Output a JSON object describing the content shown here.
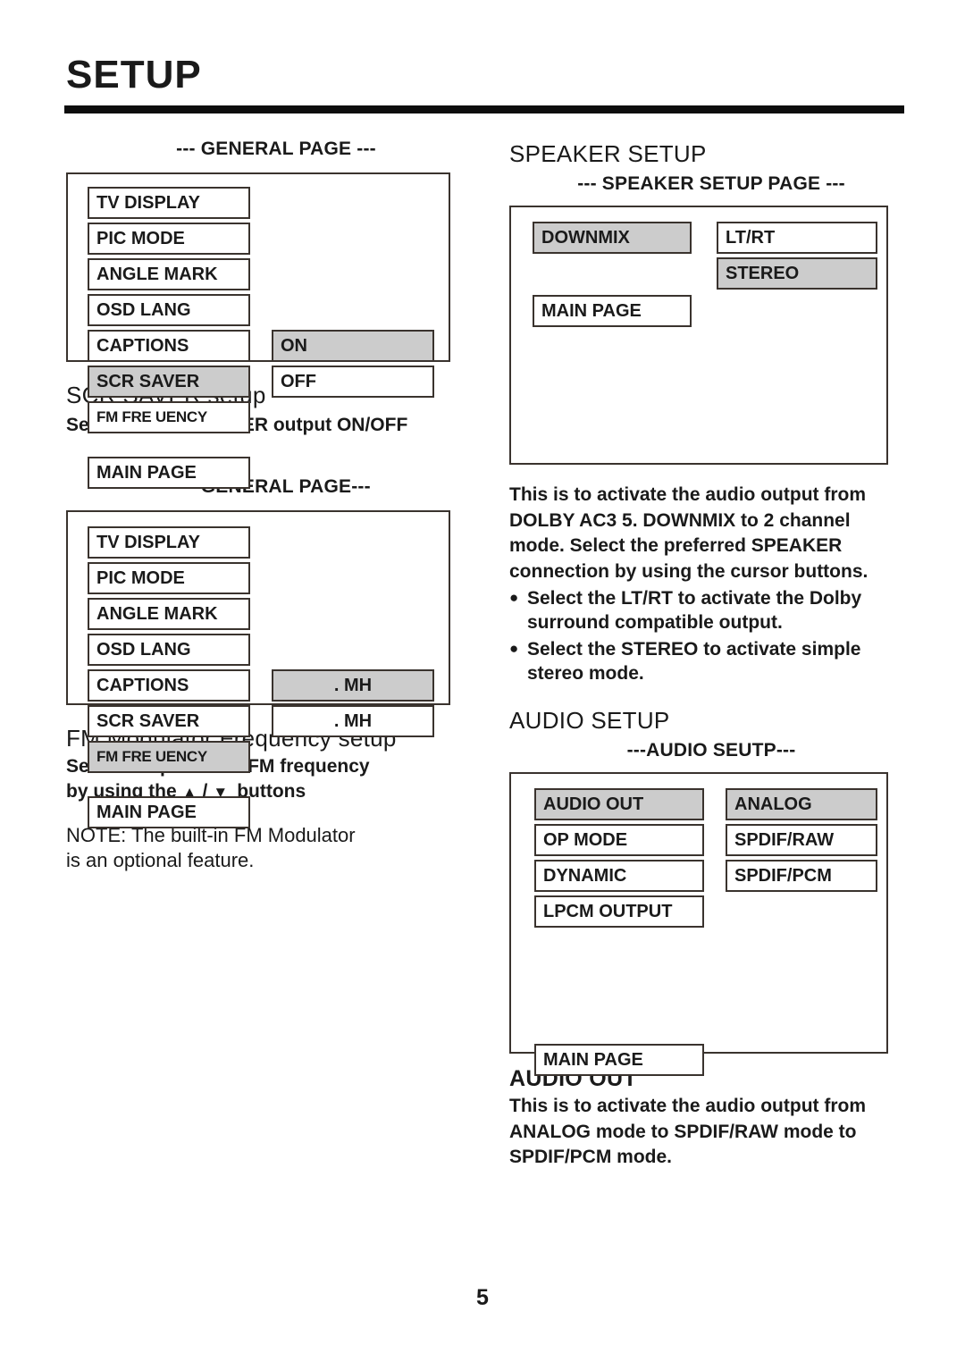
{
  "page": {
    "title": "SETUP",
    "number": "5"
  },
  "left_column": {
    "general_page_1": {
      "caption": "--- GENERAL PAGE ---",
      "menu_items": [
        {
          "label": "TV DISPLAY",
          "selected": false
        },
        {
          "label": "PIC MODE",
          "selected": false
        },
        {
          "label": "ANGLE MARK",
          "selected": false
        },
        {
          "label": "OSD LANG",
          "selected": false
        },
        {
          "label": "CAPTIONS",
          "selected": false
        },
        {
          "label": "SCR SAVER",
          "selected": true
        },
        {
          "label": "FM FRE UENCY",
          "selected": false
        }
      ],
      "main_page_label": "MAIN PAGE",
      "options": [
        {
          "label": "ON",
          "selected": true
        },
        {
          "label": "OFF",
          "selected": false
        }
      ]
    },
    "scr_saver_block": {
      "heading": "SCR SAVER setup",
      "description": "Select the SCR SAVER output ON/OFF"
    },
    "general_page_2": {
      "caption": "---GENERAL PAGE---",
      "menu_items": [
        {
          "label": "TV DISPLAY",
          "selected": false
        },
        {
          "label": "PIC MODE",
          "selected": false
        },
        {
          "label": "ANGLE MARK",
          "selected": false
        },
        {
          "label": "OSD LANG",
          "selected": false
        },
        {
          "label": "CAPTIONS",
          "selected": false
        },
        {
          "label": "SCR SAVER",
          "selected": false
        },
        {
          "label": "FM FRE UENCY",
          "selected": true
        }
      ],
      "main_page_label": "MAIN PAGE",
      "options": [
        {
          "label": ". MH",
          "selected": true
        },
        {
          "label": ". MH",
          "selected": false
        }
      ]
    },
    "fm_block": {
      "heading": "FM Modulator Frequency  setup",
      "description_line1": "Select the preferred FM frequency",
      "description_line2_a": "by using the",
      "up_icon": "▲",
      "separator": "/",
      "down_icon": "▼",
      "description_line2_b": "buttons",
      "note": "NOTE: The built-in  FM Modulator\nis an optional  feature."
    }
  },
  "right_column": {
    "speaker_setup": {
      "heading": "SPEAKER SETUP",
      "caption": "--- SPEAKER SETUP PAGE ---",
      "menu_items": [
        {
          "label": "DOWNMIX",
          "selected": true
        }
      ],
      "main_page_label": "MAIN PAGE",
      "options": [
        {
          "label": "LT/RT",
          "selected": false
        },
        {
          "label": "STEREO",
          "selected": true
        }
      ],
      "description": "This is to activate the audio output from\nDOLBY AC3 5.  DOWNMIX to 2 channel\nmode. Select the preferred SPEAKER\nconnection by using the cursor buttons.",
      "bullets": [
        "Select the LT/RT to activate the Dolby\nsurround compatible output.",
        "Select the STEREO to activate simple\nstereo mode."
      ]
    },
    "audio_setup": {
      "heading": "AUDIO SETUP",
      "caption": "---AUDIO SEUTP---",
      "menu_items": [
        {
          "label": "AUDIO  OUT",
          "selected": true
        },
        {
          "label": "OP MODE",
          "selected": false
        },
        {
          "label": "DYNAMIC",
          "selected": false
        },
        {
          "label": "LPCM OUTPUT",
          "selected": false
        }
      ],
      "main_page_label": "MAIN PAGE",
      "options": [
        {
          "label": "ANALOG",
          "selected": true
        },
        {
          "label": "SPDIF/RAW",
          "selected": false
        },
        {
          "label": "SPDIF/PCM",
          "selected": false
        }
      ],
      "audio_out_heading": "AUDIO OUT",
      "description": "This is to activate the audio output from\n ANALOG mode to SPDIF/RAW mode to\nSPDIF/PCM mode."
    }
  },
  "colors": {
    "selected_fill": "#cccccc",
    "border": "#3a332e",
    "text": "#1a1a1a"
  }
}
